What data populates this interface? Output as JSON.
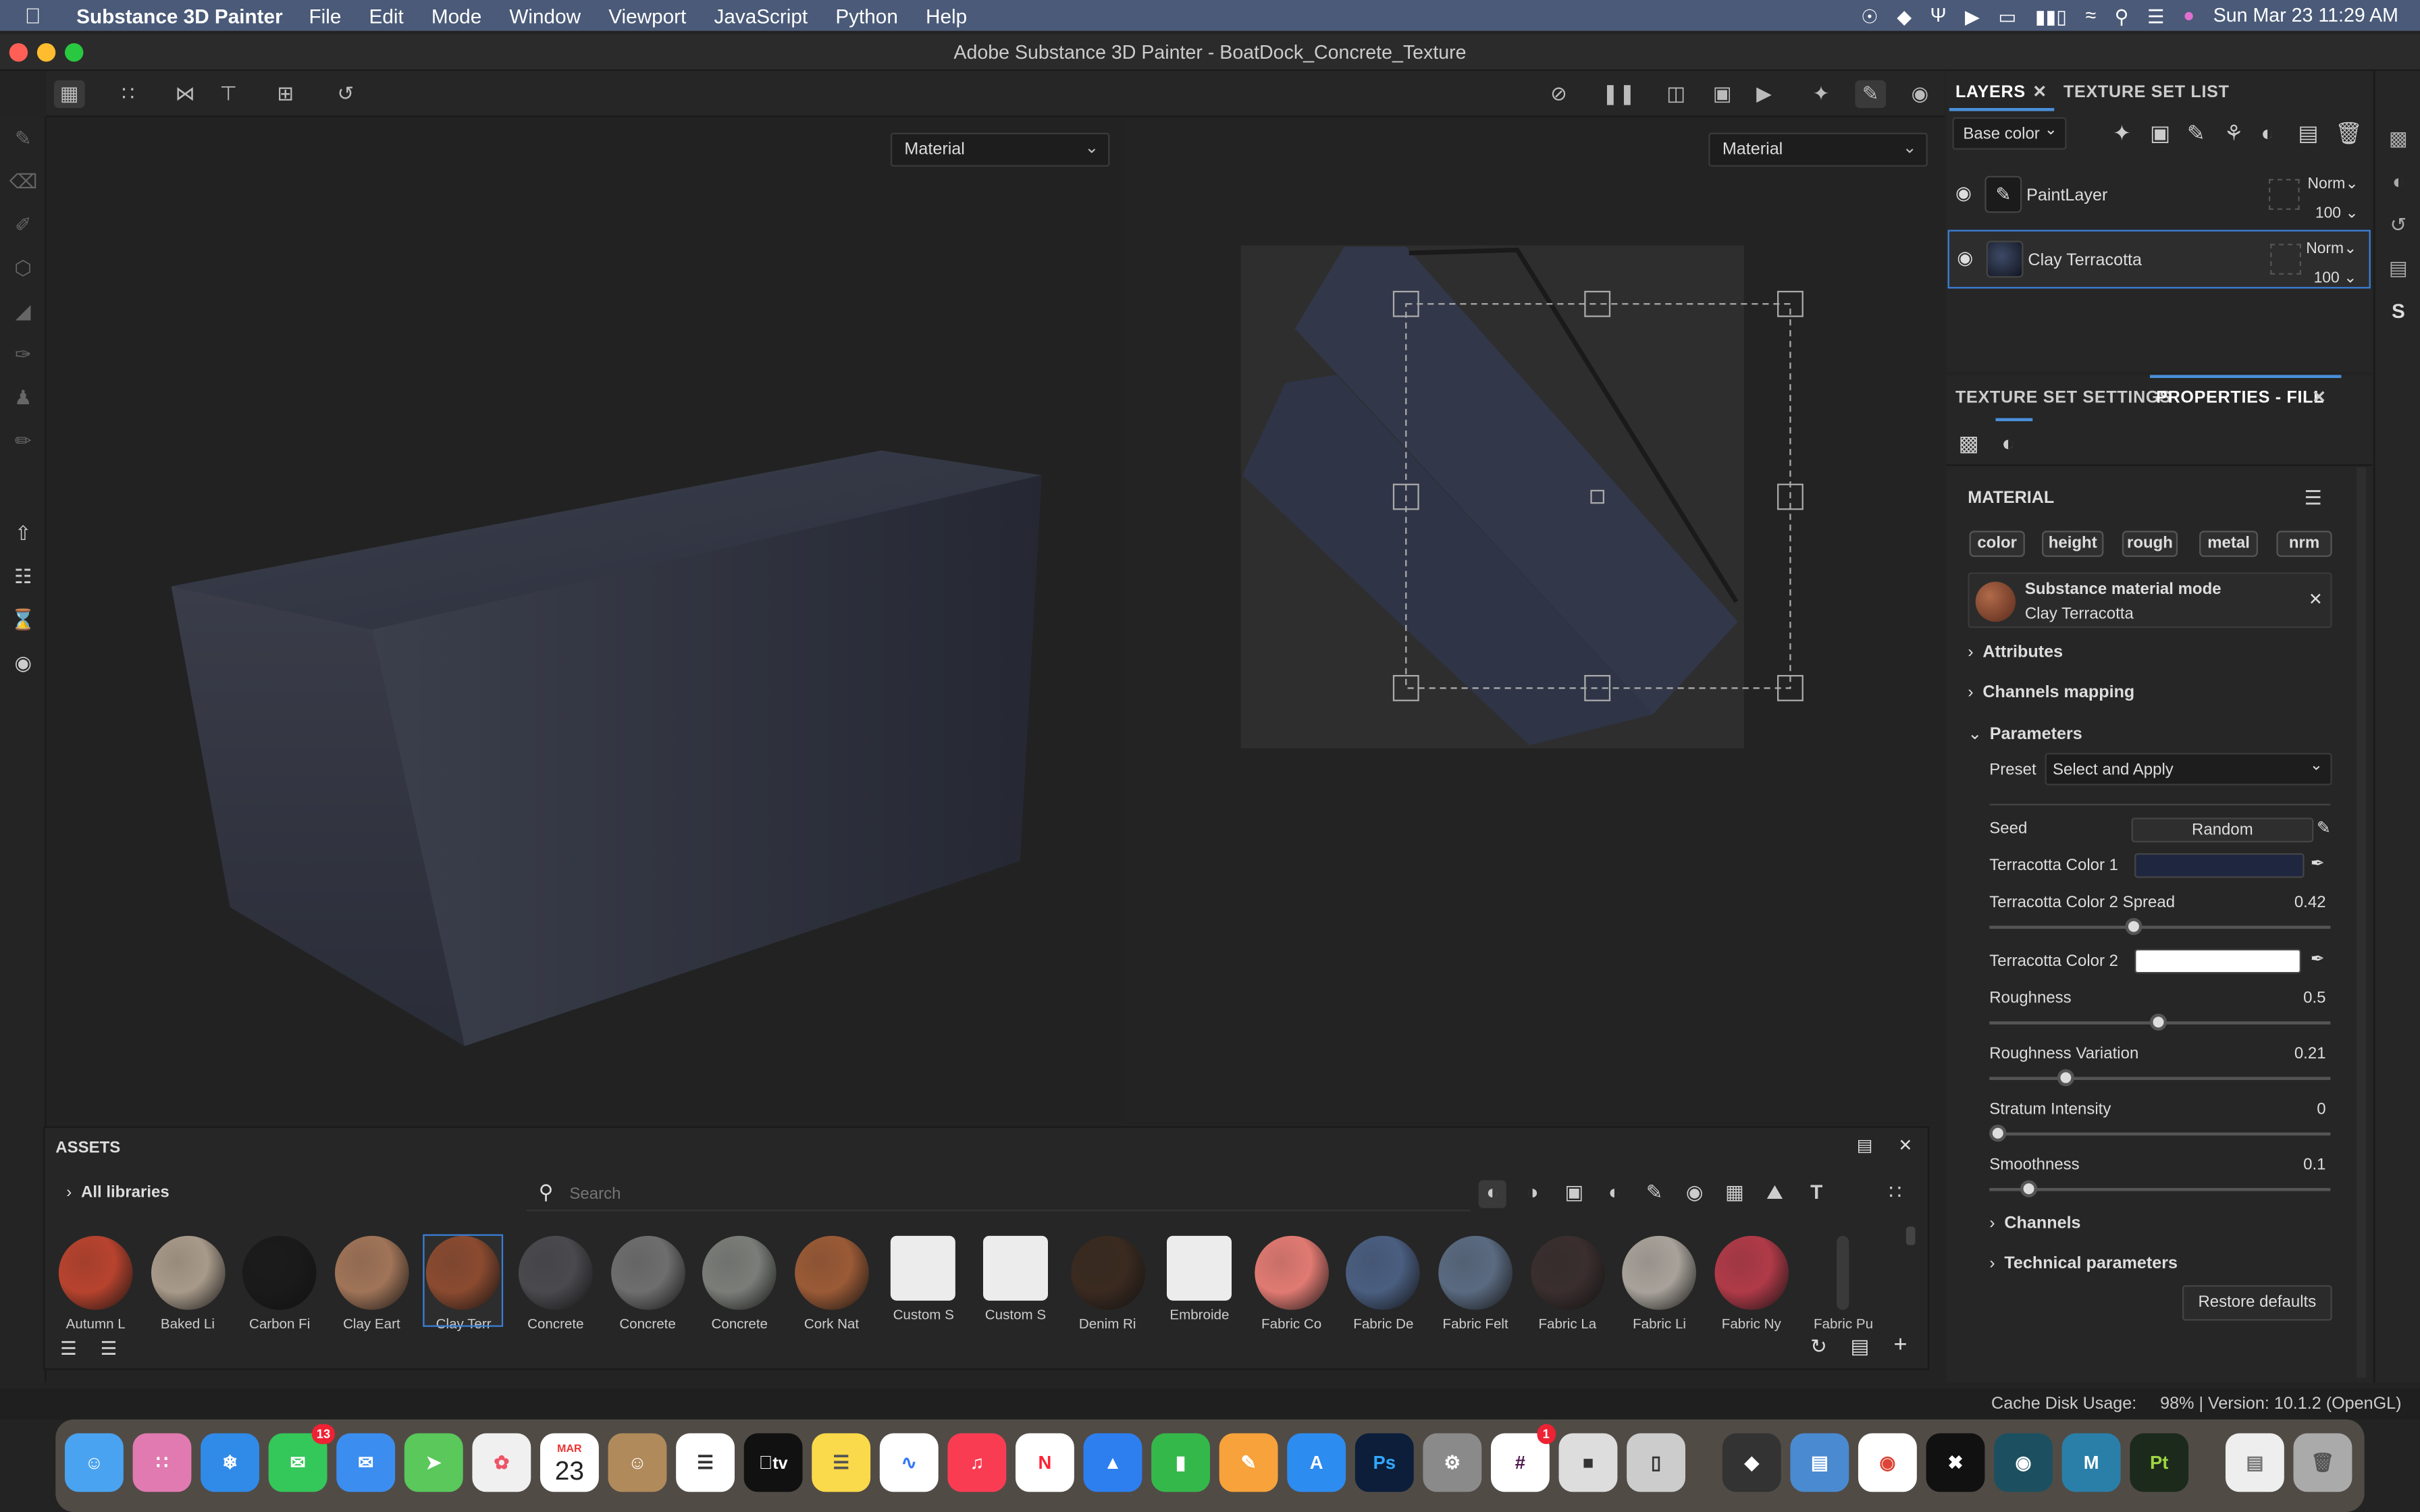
{
  "menubar": {
    "app_name": "Substance 3D Painter",
    "menus": [
      "File",
      "Edit",
      "Mode",
      "Window",
      "Viewport",
      "JavaScript",
      "Python",
      "Help"
    ],
    "clock": "Sun Mar 23  11:29 AM"
  },
  "window": {
    "title": "Adobe Substance 3D Painter - BoatDock_Concrete_Texture"
  },
  "viewports": {
    "left_mode": "Material",
    "right_mode": "Material"
  },
  "layers_panel": {
    "tab_layers": "LAYERS",
    "tab_texture_set_list": "TEXTURE SET LIST",
    "channel_select": "Base color",
    "layers": [
      {
        "name": "PaintLayer",
        "blend": "Norm",
        "opacity": "100"
      },
      {
        "name": "Clay Terracotta",
        "blend": "Norm",
        "opacity": "100"
      }
    ]
  },
  "properties_panel": {
    "tab_texture_set_settings": "TEXTURE SET SETTINGS",
    "tab_properties_fill": "PROPERTIES - FILL",
    "material_heading": "MATERIAL",
    "channel_tags": [
      "color",
      "height",
      "rough",
      "metal",
      "nrm"
    ],
    "material_mode_title": "Substance material mode",
    "material_name": "Clay Terracotta",
    "sections": {
      "attributes": "Attributes",
      "channels_mapping": "Channels mapping",
      "parameters": "Parameters",
      "channels": "Channels",
      "technical_parameters": "Technical parameters"
    },
    "preset_label": "Preset",
    "preset_value": "Select and Apply",
    "seed_label": "Seed",
    "seed_button": "Random",
    "color1_label": "Terracotta Color 1",
    "color1_hex": "#1f2740",
    "spread_label": "Terracotta Color 2 Spread",
    "spread_value": "0.42",
    "color2_label": "Terracotta Color 2",
    "color2_hex": "#ffffff",
    "roughness_label": "Roughness",
    "roughness_value": "0.5",
    "rough_var_label": "Roughness Variation",
    "rough_var_value": "0.21",
    "stratum_label": "Stratum Intensity",
    "stratum_value": "0",
    "smooth_label": "Smoothness",
    "smooth_value": "0.1",
    "restore_button": "Restore defaults"
  },
  "assets_panel": {
    "title": "ASSETS",
    "all_libraries": "All libraries",
    "search_placeholder": "Search",
    "items": [
      {
        "label": "Autumn L",
        "color": "#b7432e"
      },
      {
        "label": "Baked Li",
        "color": "#a89a8a"
      },
      {
        "label": "Carbon Fi",
        "color": "#1a1a1a"
      },
      {
        "label": "Clay Eart",
        "color": "#a07458"
      },
      {
        "label": "Clay Terr",
        "color": "#8a4a30"
      },
      {
        "label": "Concrete",
        "color": "#4a4a4e"
      },
      {
        "label": "Concrete",
        "color": "#6e6e6e"
      },
      {
        "label": "Concrete",
        "color": "#7a7d78"
      },
      {
        "label": "Cork Nat",
        "color": "#9a5a36"
      },
      {
        "label": "Custom S",
        "color": "#ececec"
      },
      {
        "label": "Custom S",
        "color": "#ececec"
      },
      {
        "label": "Denim Ri",
        "color": "#3a2a20"
      },
      {
        "label": "Embroide",
        "color": "#ececec"
      },
      {
        "label": "Fabric Co",
        "color": "#e07a72"
      },
      {
        "label": "Fabric De",
        "color": "#4a5e80"
      },
      {
        "label": "Fabric Felt",
        "color": "#5a6a80"
      },
      {
        "label": "Fabric La",
        "color": "#3a2e2e"
      },
      {
        "label": "Fabric Li",
        "color": "#a8a29a"
      },
      {
        "label": "Fabric Ny",
        "color": "#b03a48"
      },
      {
        "label": "Fabric Pu",
        "color": "#2a2a2a"
      }
    ]
  },
  "status": {
    "cache": "Cache Disk Usage:     98% | Version: 10.1.2 (OpenGL)"
  },
  "dock": {
    "messages_badge": "13",
    "calendar_month": "MAR",
    "calendar_day": "23",
    "slack_badge": "1",
    "ps_label": "Ps",
    "pt_label": "Pt",
    "tv_label": "tv"
  }
}
